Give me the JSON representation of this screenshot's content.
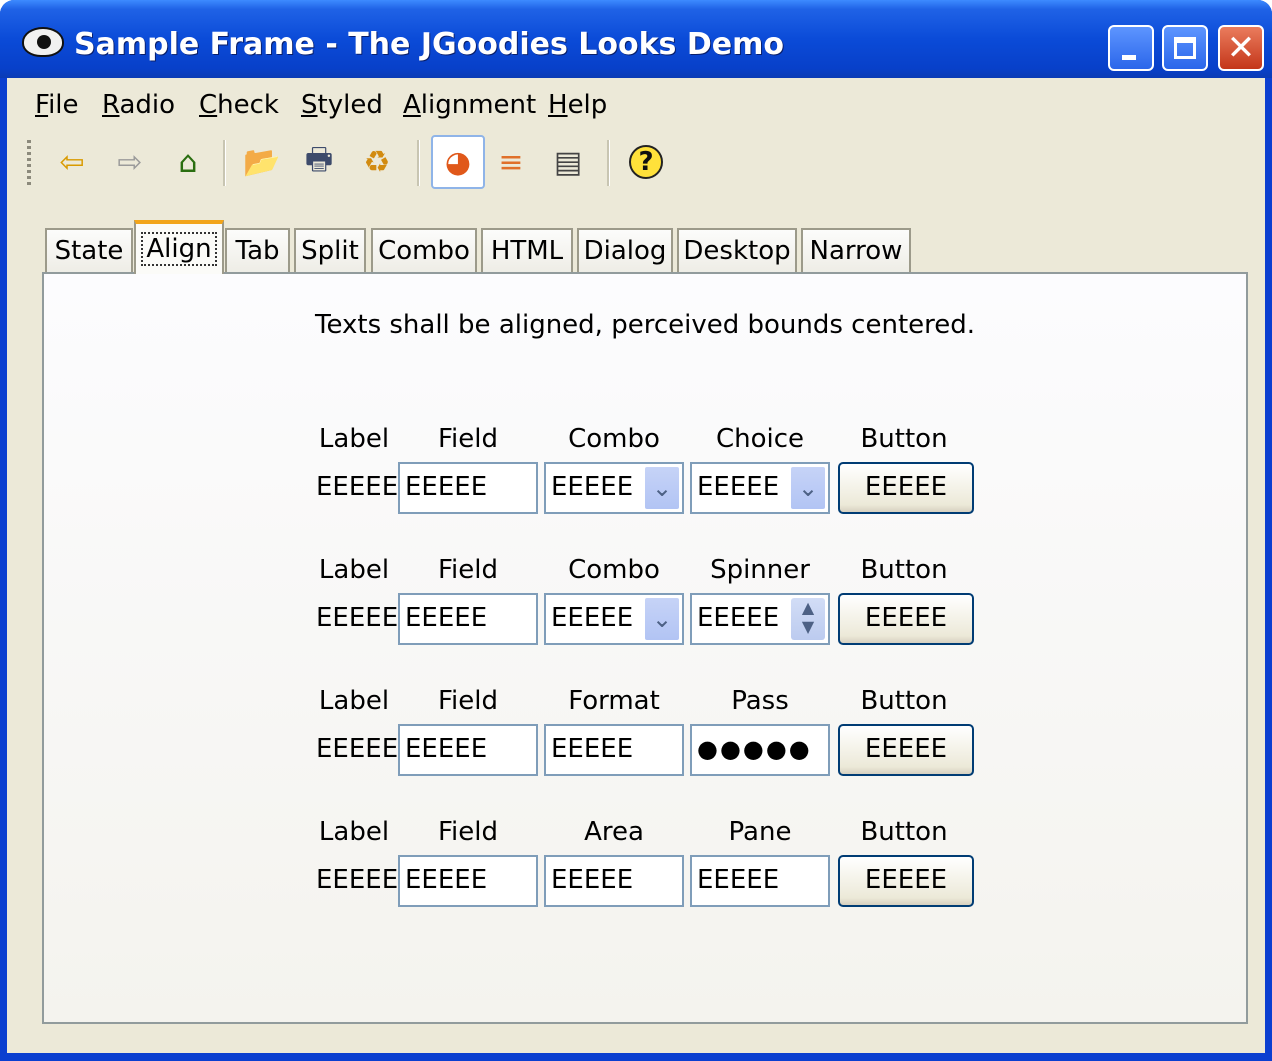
{
  "window": {
    "title": "Sample Frame - The JGoodies Looks Demo",
    "min_glyph": "",
    "max_glyph": "",
    "close_glyph": "✕"
  },
  "menu": [
    {
      "prefix": "",
      "mnemonic": "F",
      "rest": "ile"
    },
    {
      "prefix": "",
      "mnemonic": "R",
      "rest": "adio"
    },
    {
      "prefix": "",
      "mnemonic": "C",
      "rest": "heck"
    },
    {
      "prefix": "",
      "mnemonic": "S",
      "rest": "tyled"
    },
    {
      "prefix": "",
      "mnemonic": "A",
      "rest": "lignment"
    },
    {
      "prefix": "",
      "mnemonic": "H",
      "rest": "elp"
    }
  ],
  "toolbar": {
    "back_glyph": "⇦",
    "forward_glyph": "⇨",
    "home_glyph": "⌂",
    "open_glyph": "📂",
    "print_glyph": "🖶",
    "refresh_glyph": "♻",
    "pie_glyph": "◕",
    "bar_glyph": "≡",
    "table_glyph": "▤",
    "help_glyph": "?"
  },
  "tabs": [
    "State",
    "Align",
    "Tab",
    "Split",
    "Combo",
    "HTML",
    "Dialog",
    "Desktop",
    "Narrow"
  ],
  "selected_tab": "Align",
  "panel": {
    "heading": "Texts shall be aligned, perceived bounds centered.",
    "rows": [
      {
        "headers": [
          "Label",
          "Field",
          "Combo",
          "Choice",
          "Button"
        ],
        "label": "EEEEE",
        "field": "EEEEE",
        "c3": "EEEEE",
        "c4": "EEEEE",
        "button": "EEEEE",
        "c3_arrow": "⌄",
        "c4_arrow": "⌄"
      },
      {
        "headers": [
          "Label",
          "Field",
          "Combo",
          "Spinner",
          "Button"
        ],
        "label": "EEEEE",
        "field": "EEEEE",
        "c3": "EEEEE",
        "c4": "EEEEE",
        "button": "EEEEE",
        "c3_arrow": "⌄",
        "spin_up": "▲",
        "spin_down": "▼"
      },
      {
        "headers": [
          "Label",
          "Field",
          "Format",
          "Pass",
          "Button"
        ],
        "label": "EEEEE",
        "field": "EEEEE",
        "c3": "EEEEE",
        "c4": "●●●●●",
        "button": "EEEEE"
      },
      {
        "headers": [
          "Label",
          "Field",
          "Area",
          "Pane",
          "Button"
        ],
        "label": "EEEEE",
        "field": "EEEEE",
        "c3": "EEEEE",
        "c4": "EEEEE",
        "button": "EEEEE"
      }
    ]
  }
}
